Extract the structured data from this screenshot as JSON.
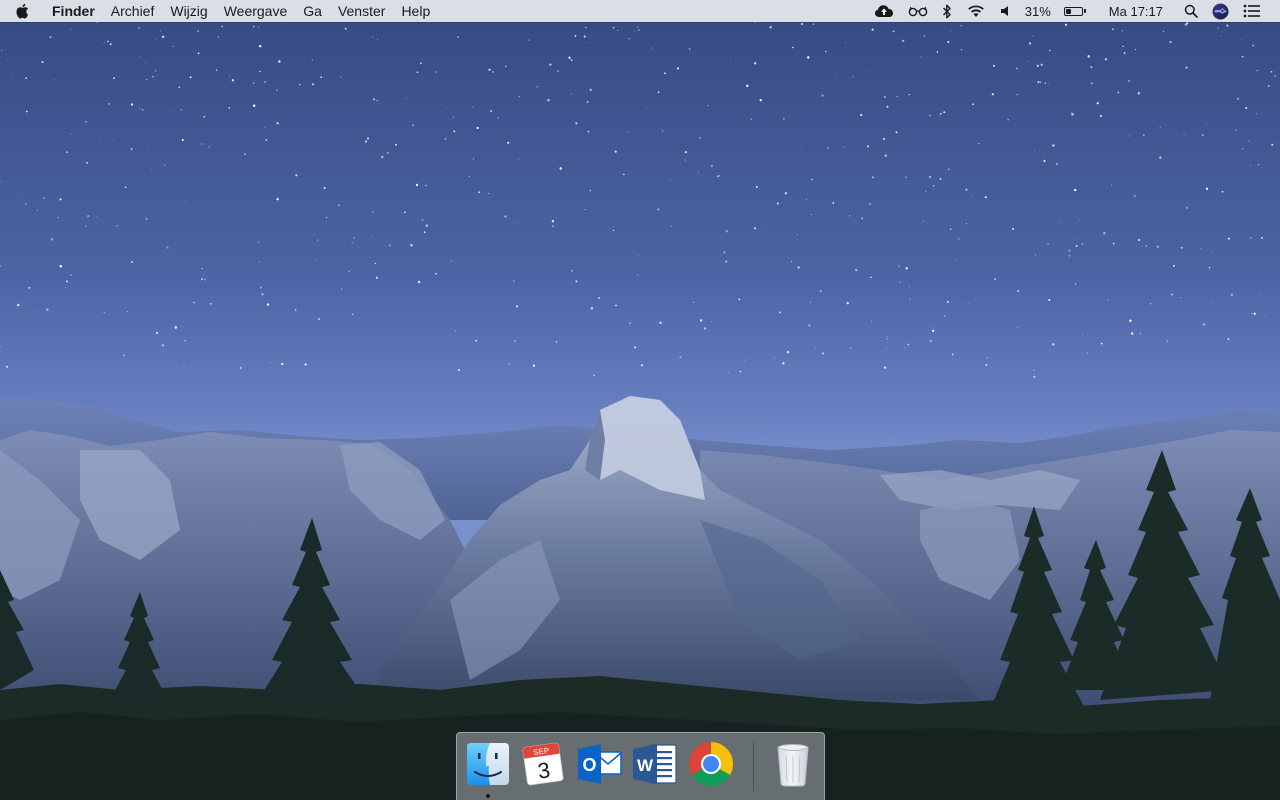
{
  "menubar": {
    "apple_icon": "apple-logo-icon",
    "app_name": "Finder",
    "menus": [
      "Archief",
      "Wijzig",
      "Weergave",
      "Ga",
      "Venster",
      "Help"
    ],
    "status_icons": [
      "cloud-upload-icon",
      "glasses-icon",
      "bluetooth-icon",
      "wifi-icon",
      "volume-icon"
    ],
    "battery_percent_text": "31%",
    "battery_level": 0.31,
    "clock": "Ma 17:17",
    "extra_icons": [
      "spotlight-search-icon",
      "siri-icon",
      "notification-center-icon"
    ]
  },
  "dock": {
    "apps": [
      {
        "name": "Finder",
        "icon": "finder-icon",
        "running": true
      },
      {
        "name": "Agenda",
        "icon": "calendar-icon",
        "month": "SEP",
        "day": "3",
        "running": false
      },
      {
        "name": "Outlook",
        "icon": "outlook-icon",
        "letter": "O",
        "running": false
      },
      {
        "name": "Word",
        "icon": "word-icon",
        "letter": "W",
        "running": false
      },
      {
        "name": "Chrome",
        "icon": "chrome-icon",
        "running": false
      }
    ],
    "trash": {
      "name": "Prullenmand",
      "icon": "trash-icon"
    }
  },
  "colors": {
    "menubar_bg": "#e8eaf0",
    "sky_top": "#3a4f86",
    "sky_horizon": "#7088c6",
    "outlook_blue": "#0a64c8",
    "word_blue": "#2b5797",
    "calendar_red": "#e0443a"
  }
}
